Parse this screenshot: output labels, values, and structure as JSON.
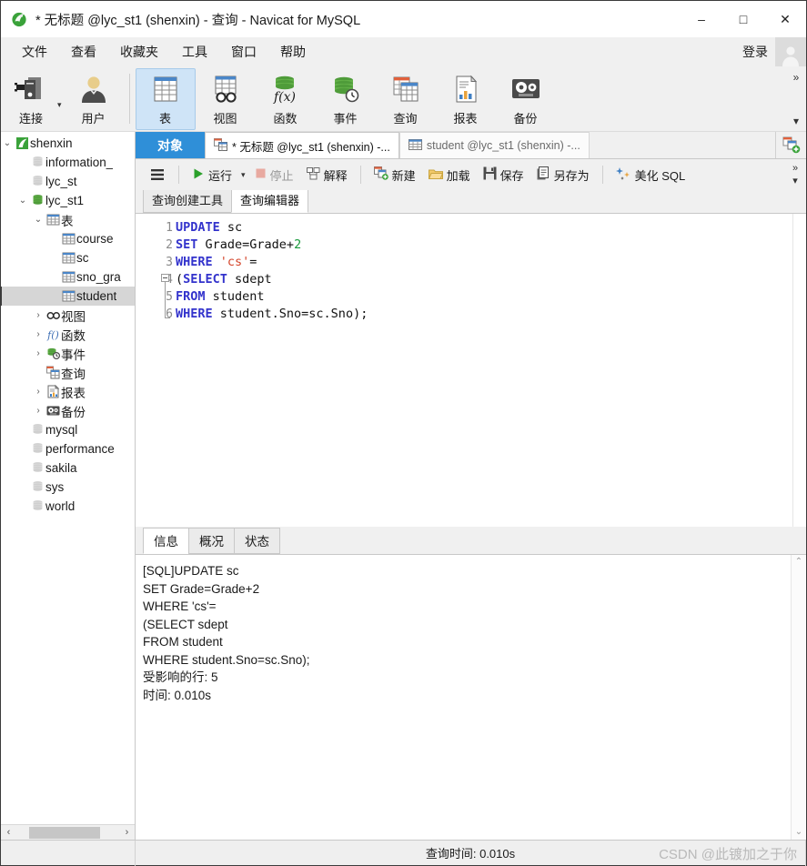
{
  "window": {
    "title": "* 无标题 @lyc_st1 (shenxin) - 查询 - Navicat for MySQL",
    "logo_icon": "navicat-logo-icon",
    "minimize_icon": "minimize-icon",
    "maximize_icon": "maximize-icon",
    "close_icon": "close-icon",
    "minimize_glyph": "–",
    "maximize_glyph": "□",
    "close_glyph": "✕"
  },
  "menubar": {
    "items": [
      {
        "label": "文件",
        "name": "menu-file"
      },
      {
        "label": "查看",
        "name": "menu-view"
      },
      {
        "label": "收藏夹",
        "name": "menu-favorites"
      },
      {
        "label": "工具",
        "name": "menu-tools"
      },
      {
        "label": "窗口",
        "name": "menu-window"
      },
      {
        "label": "帮助",
        "name": "menu-help"
      }
    ],
    "login_label": "登录",
    "avatar_icon": "user-avatar-icon"
  },
  "toolbar": {
    "items": [
      {
        "label": "连接",
        "icon": "connection-icon",
        "active": false
      },
      {
        "label": "用户",
        "icon": "user-icon",
        "active": false
      },
      {
        "label": "表",
        "icon": "table-icon",
        "active": true
      },
      {
        "label": "视图",
        "icon": "view-icon",
        "active": false
      },
      {
        "label": "函数",
        "icon": "function-icon",
        "active": false
      },
      {
        "label": "事件",
        "icon": "event-icon",
        "active": false
      },
      {
        "label": "查询",
        "icon": "query-icon",
        "active": false
      },
      {
        "label": "报表",
        "icon": "report-icon",
        "active": false
      },
      {
        "label": "备份",
        "icon": "backup-icon",
        "active": false
      }
    ],
    "dropdown_glyph": "▾",
    "overflow_glyph": "»",
    "overflow_down_glyph": "▾"
  },
  "sidebar": {
    "tree": [
      {
        "label": "shenxin",
        "icon": "connection-node-icon",
        "indent": 0,
        "twist": "⌄",
        "selected": false
      },
      {
        "label": "information_",
        "icon": "database-gray-icon",
        "indent": 1,
        "twist": "",
        "selected": false
      },
      {
        "label": "lyc_st",
        "icon": "database-gray-icon",
        "indent": 1,
        "twist": "",
        "selected": false
      },
      {
        "label": "lyc_st1",
        "icon": "database-green-icon",
        "indent": 1,
        "twist": "⌄",
        "selected": false
      },
      {
        "label": "表",
        "icon": "table-folder-icon",
        "indent": 2,
        "twist": "⌄",
        "selected": false
      },
      {
        "label": "course",
        "icon": "table-item-icon",
        "indent": 3,
        "twist": "",
        "selected": false
      },
      {
        "label": "sc",
        "icon": "table-item-icon",
        "indent": 3,
        "twist": "",
        "selected": false
      },
      {
        "label": "sno_gra",
        "icon": "table-item-icon",
        "indent": 3,
        "twist": "",
        "selected": false
      },
      {
        "label": "student",
        "icon": "table-item-icon",
        "indent": 3,
        "twist": "",
        "selected": true
      },
      {
        "label": "视图",
        "icon": "view-folder-icon",
        "indent": 2,
        "twist": "›",
        "selected": false
      },
      {
        "label": "函数",
        "icon": "function-folder-icon",
        "indent": 2,
        "twist": "›",
        "selected": false
      },
      {
        "label": "事件",
        "icon": "event-folder-icon",
        "indent": 2,
        "twist": "›",
        "selected": false
      },
      {
        "label": "查询",
        "icon": "query-folder-icon",
        "indent": 2,
        "twist": "",
        "selected": false
      },
      {
        "label": "报表",
        "icon": "report-folder-icon",
        "indent": 2,
        "twist": "›",
        "selected": false
      },
      {
        "label": "备份",
        "icon": "backup-folder-icon",
        "indent": 2,
        "twist": "›",
        "selected": false
      },
      {
        "label": "mysql",
        "icon": "database-gray-icon",
        "indent": 1,
        "twist": "",
        "selected": false
      },
      {
        "label": "performance",
        "icon": "database-gray-icon",
        "indent": 1,
        "twist": "",
        "selected": false
      },
      {
        "label": "sakila",
        "icon": "database-gray-icon",
        "indent": 1,
        "twist": "",
        "selected": false
      },
      {
        "label": "sys",
        "icon": "database-gray-icon",
        "indent": 1,
        "twist": "",
        "selected": false
      },
      {
        "label": "world",
        "icon": "database-gray-icon",
        "indent": 1,
        "twist": "",
        "selected": false
      }
    ],
    "scroll_left_glyph": "‹",
    "scroll_right_glyph": "›"
  },
  "tabstrip": {
    "object_tab": "对象",
    "documents": [
      {
        "label": "* 无标题 @lyc_st1 (shenxin) -...",
        "icon": "query-tab-icon",
        "active": true
      },
      {
        "label": "student @lyc_st1 (shenxin) -...",
        "icon": "table-tab-icon",
        "active": false
      }
    ],
    "new_tab_icon": "new-tab-icon"
  },
  "query_toolbar": {
    "menu_icon": "hamburger-menu-icon",
    "buttons": [
      {
        "label": "运行",
        "icon": "run-icon",
        "disabled": false,
        "has_caret": true
      },
      {
        "label": "停止",
        "icon": "stop-icon",
        "disabled": true,
        "has_caret": false
      },
      {
        "label": "解释",
        "icon": "explain-icon",
        "disabled": false,
        "has_caret": false
      },
      {
        "label": "新建",
        "icon": "new-query-icon",
        "disabled": false,
        "has_caret": false
      },
      {
        "label": "加载",
        "icon": "load-icon",
        "disabled": false,
        "has_caret": false
      },
      {
        "label": "保存",
        "icon": "save-icon",
        "disabled": false,
        "has_caret": false
      },
      {
        "label": "另存为",
        "icon": "save-as-icon",
        "disabled": false,
        "has_caret": false
      },
      {
        "label": "美化 SQL",
        "icon": "beautify-sql-icon",
        "disabled": false,
        "has_caret": false
      }
    ],
    "overflow_glyph": "»",
    "overflow_down_glyph": "▾",
    "caret_glyph": "▾"
  },
  "editor": {
    "subtabs": [
      {
        "label": "查询创建工具",
        "active": false
      },
      {
        "label": "查询编辑器",
        "active": true
      }
    ],
    "line_numbers": [
      "1",
      "2",
      "3",
      "4",
      "5",
      "6"
    ],
    "sql_lines": [
      {
        "num": "1",
        "tokens": [
          {
            "t": "UPDATE",
            "c": "kw"
          },
          {
            "t": " sc",
            "c": ""
          }
        ]
      },
      {
        "num": "2",
        "tokens": [
          {
            "t": "SET",
            "c": "kw"
          },
          {
            "t": " Grade=Grade+",
            "c": ""
          },
          {
            "t": "2",
            "c": "num"
          }
        ]
      },
      {
        "num": "3",
        "tokens": [
          {
            "t": "WHERE",
            "c": "kw"
          },
          {
            "t": " ",
            "c": ""
          },
          {
            "t": "'cs'",
            "c": "str"
          },
          {
            "t": "=",
            "c": ""
          }
        ]
      },
      {
        "num": "4",
        "tokens": [
          {
            "t": "(",
            "c": ""
          },
          {
            "t": "SELECT",
            "c": "kw"
          },
          {
            "t": " sdept",
            "c": ""
          }
        ]
      },
      {
        "num": "5",
        "tokens": [
          {
            "t": "FROM",
            "c": "kw"
          },
          {
            "t": " student",
            "c": ""
          }
        ]
      },
      {
        "num": "6",
        "tokens": [
          {
            "t": "WHERE",
            "c": "kw"
          },
          {
            "t": " student.Sno=sc.Sno);",
            "c": ""
          }
        ]
      }
    ]
  },
  "results": {
    "tabs": [
      {
        "label": "信息",
        "active": true
      },
      {
        "label": "概况",
        "active": false
      },
      {
        "label": "状态",
        "active": false
      }
    ],
    "messages": [
      "[SQL]UPDATE sc",
      "SET Grade=Grade+2",
      "WHERE 'cs'=",
      "(SELECT sdept",
      "FROM student",
      "WHERE student.Sno=sc.Sno);",
      "受影响的行: 5",
      "时间: 0.010s"
    ],
    "scroll_up_glyph": "⌃",
    "scroll_down_glyph": "⌄"
  },
  "statusbar": {
    "query_time_label": "查询时间: 0.010s",
    "watermark": "CSDN @此镀加之于你"
  },
  "colors": {
    "accent": "#2f8fd8",
    "toolbar_active": "#cfe4f7",
    "keyword": "#3333cc",
    "string": "#d4442a",
    "number": "#1a9a3c",
    "selection": "#d6d6d6"
  }
}
